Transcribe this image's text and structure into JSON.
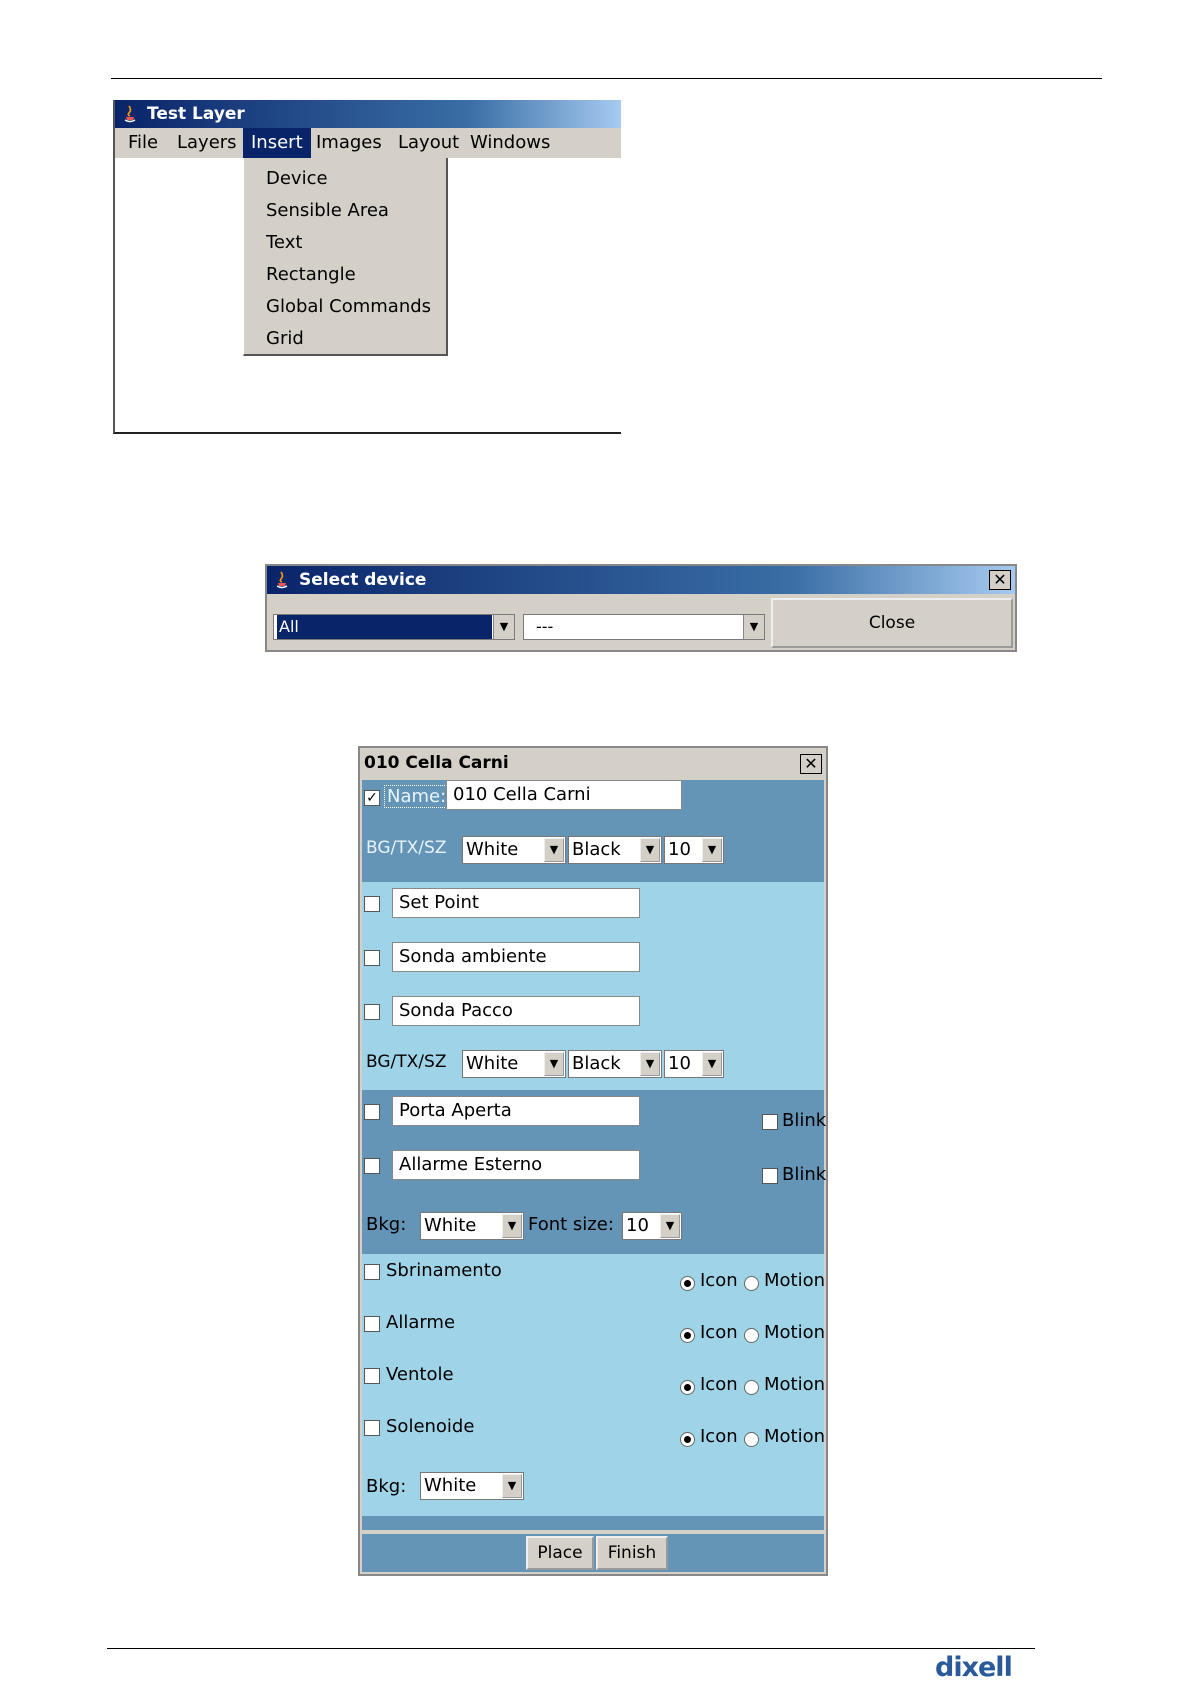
{
  "window1": {
    "title": "Test Layer",
    "menu": [
      "File",
      "Layers",
      "Insert",
      "Images",
      "Layout",
      "Windows"
    ],
    "active_menu": "Insert",
    "dropdown": [
      "Device",
      "Sensible Area",
      "Text",
      "Rectangle",
      "Global Commands",
      "Grid"
    ]
  },
  "window2": {
    "title": "Select device",
    "combo1": "All",
    "combo2": "---",
    "close_button": "Close",
    "close_glyph": "✕"
  },
  "window3": {
    "title": "010 Cella Carni",
    "close_glyph": "✕",
    "name_label": "Name:",
    "name_value": "010 Cella Carni",
    "bgtxsz_label": "BG/TX/SZ",
    "bg1": "White",
    "tx1": "Black",
    "sz1": "10",
    "field_set_point": "Set Point",
    "field_sonda_ambiente": "Sonda ambiente",
    "field_sonda_pacco": "Sonda Pacco",
    "bg2": "White",
    "tx2": "Black",
    "sz2": "10",
    "field_porta_aperta": "Porta Aperta",
    "field_allarme_esterno": "Allarme Esterno",
    "blink_label": "Blink",
    "bkg_label": "Bkg:",
    "bkg1": "White",
    "font_size_label": "Font size:",
    "font_size": "10",
    "icons": [
      "Sbrinamento",
      "Allarme",
      "Ventole",
      "Solenoide"
    ],
    "icon_label": "Icon",
    "motion_label": "Motion",
    "bkg2": "White",
    "place_button": "Place",
    "finish_button": "Finish"
  },
  "footer": {
    "logo": "dixell"
  }
}
